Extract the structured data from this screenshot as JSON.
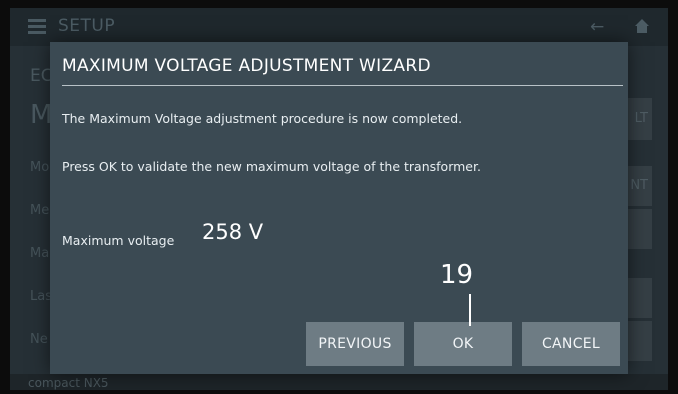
{
  "background": {
    "title": "SETUP",
    "section": "EC",
    "big_text": "M",
    "rows": [
      "Mo",
      "Me",
      "Ma",
      "Las",
      "Ne"
    ],
    "buttons": [
      "LT",
      "NT",
      "",
      "",
      ""
    ],
    "footer": "compact NX5"
  },
  "dialog": {
    "title": "MAXIMUM VOLTAGE ADJUSTMENT WIZARD",
    "message_line1": "The Maximum Voltage adjustment procedure is now completed.",
    "message_line2": "Press OK to validate the new maximum voltage of the transformer.",
    "voltage_label": "Maximum voltage",
    "voltage_value": "258 V",
    "buttons": {
      "previous": "PREVIOUS",
      "ok": "OK",
      "cancel": "CANCEL"
    }
  },
  "annotation": {
    "step": "19"
  },
  "colors": {
    "dialog_bg": "#3b4a53",
    "button_bg": "#6e7c84",
    "screen_bg": "#263036"
  },
  "icons": [
    "hamburger-menu-icon",
    "back-arrow-icon",
    "home-icon"
  ]
}
